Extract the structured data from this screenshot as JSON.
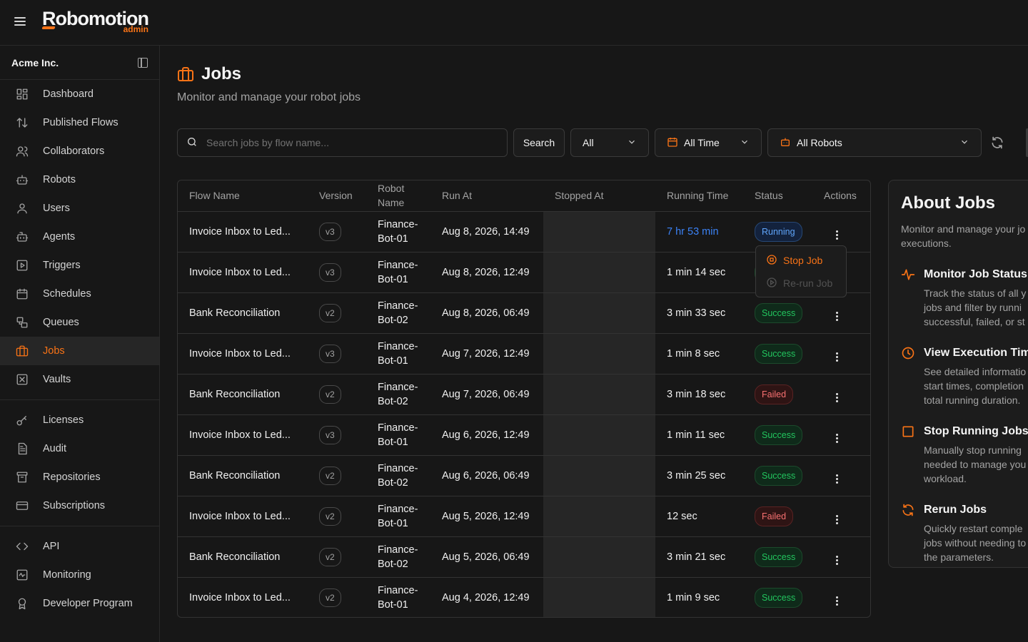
{
  "app": {
    "logo_main": "Robomotion",
    "logo_sub": "admin"
  },
  "org": {
    "name": "Acme Inc."
  },
  "sidebar": {
    "items": [
      {
        "label": "Dashboard",
        "icon": "dashboard-icon"
      },
      {
        "label": "Published Flows",
        "icon": "arrows-icon"
      },
      {
        "label": "Collaborators",
        "icon": "collaborators-icon"
      },
      {
        "label": "Robots",
        "icon": "robot-icon"
      },
      {
        "label": "Users",
        "icon": "user-icon"
      },
      {
        "label": "Agents",
        "icon": "agent-icon"
      },
      {
        "label": "Triggers",
        "icon": "trigger-icon"
      },
      {
        "label": "Schedules",
        "icon": "calendar-icon"
      },
      {
        "label": "Queues",
        "icon": "queue-icon"
      },
      {
        "label": "Jobs",
        "icon": "briefcase-icon",
        "active": true
      },
      {
        "label": "Vaults",
        "icon": "vault-icon"
      }
    ],
    "items2": [
      {
        "label": "Licenses",
        "icon": "key-icon"
      },
      {
        "label": "Audit",
        "icon": "audit-icon"
      },
      {
        "label": "Repositories",
        "icon": "archive-icon"
      },
      {
        "label": "Subscriptions",
        "icon": "card-icon"
      }
    ],
    "items3": [
      {
        "label": "API",
        "icon": "code-icon"
      },
      {
        "label": "Monitoring",
        "icon": "monitoring-icon"
      },
      {
        "label": "Developer Program",
        "icon": "award-icon"
      }
    ]
  },
  "page": {
    "title": "Jobs",
    "subtitle": "Monitor and manage your robot jobs"
  },
  "filters": {
    "search_placeholder": "Search jobs by flow name...",
    "search_value": "",
    "search_button": "Search",
    "status_select": "All",
    "time_select": "All Time",
    "robot_select": "All Robots"
  },
  "table": {
    "headers": [
      "Flow Name",
      "Version",
      "Robot Name",
      "Run At",
      "Stopped At",
      "Running Time",
      "Status",
      "Actions"
    ],
    "rows": [
      {
        "flow": "Invoice Inbox to Led...",
        "version": "v3",
        "robot": "Finance-Bot-01",
        "run_at": "Aug 8, 2026, 14:49",
        "stopped_at": "",
        "running_time": "7 hr 53 min",
        "status": "Running"
      },
      {
        "flow": "Invoice Inbox to Led...",
        "version": "v3",
        "robot": "Finance-Bot-01",
        "run_at": "Aug 8, 2026, 12:49",
        "stopped_at": "",
        "running_time": "1 min 14 sec",
        "status": "Success"
      },
      {
        "flow": "Bank Reconciliation",
        "version": "v2",
        "robot": "Finance-Bot-02",
        "run_at": "Aug 8, 2026, 06:49",
        "stopped_at": "",
        "running_time": "3 min 33 sec",
        "status": "Success"
      },
      {
        "flow": "Invoice Inbox to Led...",
        "version": "v3",
        "robot": "Finance-Bot-01",
        "run_at": "Aug 7, 2026, 12:49",
        "stopped_at": "",
        "running_time": "1 min 8 sec",
        "status": "Success"
      },
      {
        "flow": "Bank Reconciliation",
        "version": "v2",
        "robot": "Finance-Bot-02",
        "run_at": "Aug 7, 2026, 06:49",
        "stopped_at": "",
        "running_time": "3 min 18 sec",
        "status": "Failed"
      },
      {
        "flow": "Invoice Inbox to Led...",
        "version": "v3",
        "robot": "Finance-Bot-01",
        "run_at": "Aug 6, 2026, 12:49",
        "stopped_at": "",
        "running_time": "1 min 11 sec",
        "status": "Success"
      },
      {
        "flow": "Bank Reconciliation",
        "version": "v2",
        "robot": "Finance-Bot-02",
        "run_at": "Aug 6, 2026, 06:49",
        "stopped_at": "",
        "running_time": "3 min 25 sec",
        "status": "Success"
      },
      {
        "flow": "Invoice Inbox to Led...",
        "version": "v2",
        "robot": "Finance-Bot-01",
        "run_at": "Aug 5, 2026, 12:49",
        "stopped_at": "",
        "running_time": "12 sec",
        "status": "Failed"
      },
      {
        "flow": "Bank Reconciliation",
        "version": "v2",
        "robot": "Finance-Bot-02",
        "run_at": "Aug 5, 2026, 06:49",
        "stopped_at": "",
        "running_time": "3 min 21 sec",
        "status": "Success"
      },
      {
        "flow": "Invoice Inbox to Led...",
        "version": "v2",
        "robot": "Finance-Bot-01",
        "run_at": "Aug 4, 2026, 12:49",
        "stopped_at": "",
        "running_time": "1 min 9 sec",
        "status": "Success"
      }
    ]
  },
  "actions_menu": {
    "stop": "Stop Job",
    "rerun": "Re-run Job"
  },
  "about": {
    "title": "About Jobs",
    "subtitle": "Monitor and manage your jo executions.",
    "features": [
      {
        "title": "Monitor Job Status",
        "desc": "Track the status of all y\njobs and filter by runni\nsuccessful, failed, or st",
        "icon": "activity-icon"
      },
      {
        "title": "View Execution Tim",
        "desc": "See detailed informatio\nstart times, completion\ntotal running duration.",
        "icon": "clock-icon"
      },
      {
        "title": "Stop Running Jobs",
        "desc": "Manually stop running\nneeded to manage you\nworkload.",
        "icon": "stop-square-icon"
      },
      {
        "title": "Rerun Jobs",
        "desc": "Quickly restart comple\njobs without needing to\nthe parameters.",
        "icon": "refresh-icon"
      }
    ]
  },
  "colors": {
    "accent": "#f97316",
    "success": "#22c55e",
    "failed": "#f87171",
    "running": "#3b82f6",
    "background": "#171717"
  }
}
